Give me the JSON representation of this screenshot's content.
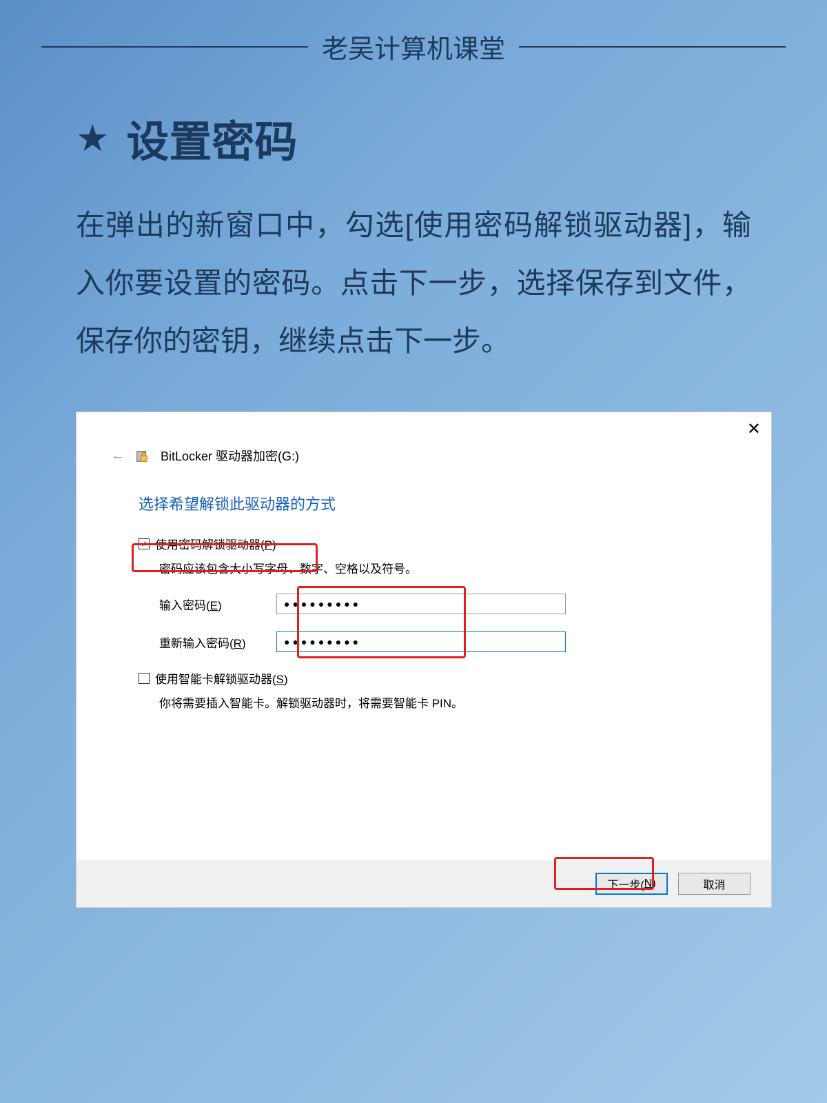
{
  "header": {
    "title": "老吴计算机课堂"
  },
  "section": {
    "star": "★",
    "title": "设置密码"
  },
  "description": "在弹出的新窗口中，勾选[使用密码解锁驱动器]，输入你要设置的密码。点击下一步，选择保存到文件，保存你的密钥，继续点击下一步。",
  "dialog": {
    "close": "✕",
    "back_arrow": "←",
    "title": "BitLocker 驱动器加密(G:)",
    "subtitle": "选择希望解锁此驱动器的方式",
    "option1": {
      "checked": true,
      "checkmark": "✓",
      "label_pre": "使用密码解锁驱动器(",
      "label_u": "P",
      "label_post": ")",
      "helper": "密码应该包含大小写字母、数字、空格以及符号。"
    },
    "password1": {
      "label_pre": "输入密码(",
      "label_u": "E",
      "label_post": ")",
      "value": "●●●●●●●●●"
    },
    "password2": {
      "label_pre": "重新输入密码(",
      "label_u": "R",
      "label_post": ")",
      "value": "●●●●●●●●●"
    },
    "option2": {
      "checked": false,
      "label_pre": "使用智能卡解锁驱动器(",
      "label_u": "S",
      "label_post": ")",
      "helper": "你将需要插入智能卡。解锁驱动器时，将需要智能卡 PIN。"
    },
    "footer": {
      "next_pre": "下一步(",
      "next_u": "N",
      "next_post": ")",
      "cancel": "取消"
    }
  }
}
